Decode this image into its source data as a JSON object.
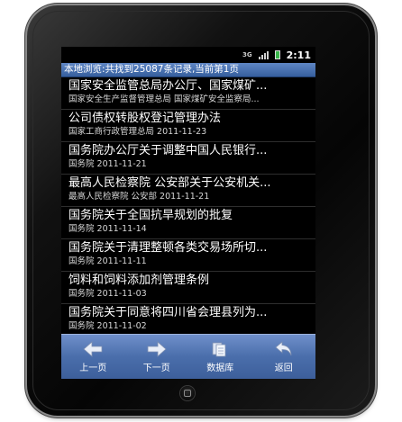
{
  "status": {
    "network": "3G",
    "time": "2:11"
  },
  "info": "本地浏览:共找到25087条记录,当前第1页",
  "items": [
    {
      "title": "国家安全监管总局办公厅、国家煤矿...",
      "sub": "国家安全生产监督管理总局 国家煤矿安全监察局..."
    },
    {
      "title": "公司债权转股权登记管理办法",
      "sub": "国家工商行政管理总局 2011-11-23"
    },
    {
      "title": "国务院办公厅关于调整中国人民银行...",
      "sub": "国务院 2011-11-21"
    },
    {
      "title": "最高人民检察院 公安部关于公安机关...",
      "sub": "最高人民检察院 公安部 2011-11-21"
    },
    {
      "title": "国务院关于全国抗旱规划的批复",
      "sub": "国务院 2011-11-14"
    },
    {
      "title": "国务院关于清理整顿各类交易场所切...",
      "sub": "国务院 2011-11-11"
    },
    {
      "title": "饲料和饲料添加剂管理条例",
      "sub": "国务院 2011-11-03"
    },
    {
      "title": "国务院关于同意将四川省会理县列为...",
      "sub": "国务院 2011-11-02"
    }
  ],
  "toolbar": {
    "prev": "上一页",
    "next": "下一页",
    "database": "数据库",
    "back": "返回"
  },
  "colors": {
    "accent": "#4a6eab",
    "battery": "#39b54a"
  }
}
